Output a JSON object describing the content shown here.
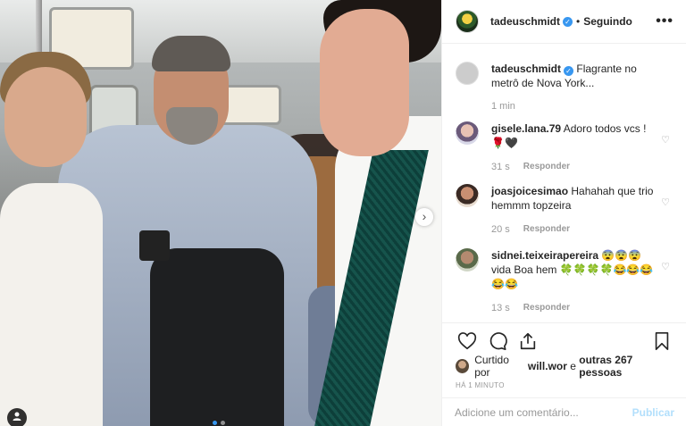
{
  "post": {
    "username": "tadeuschmidt",
    "follow_status": "Seguindo",
    "more_icon": "•••"
  },
  "caption": {
    "username": "tadeuschmidt",
    "text": "Flagrante no metrô de Nova York...",
    "time": "1 min"
  },
  "comments": [
    {
      "username": "gisele.lana.79",
      "text": "Adoro todos vcs ! 🌹🖤",
      "time": "31 s",
      "reply": "Responder"
    },
    {
      "username": "joasjoicesimao",
      "text": "Hahahah que trio hemmm topzeira",
      "time": "20 s",
      "reply": "Responder"
    },
    {
      "username": "sidnei.teixeirapereira",
      "text": "😨😨😨vida Boa hem 🍀🍀🍀🍀😂😂😂😂😂",
      "time": "13 s",
      "reply": "Responder"
    }
  ],
  "likes": {
    "prefix": "Curtido por",
    "first_user": "will.wor",
    "connector": "e",
    "others": "outras 267 pessoas"
  },
  "timestamp": "HÁ 1 MINUTO",
  "add_comment": {
    "placeholder": "Adicione um comentário...",
    "post_label": "Publicar"
  },
  "icons": {
    "verified": "verified-badge",
    "heart": "heart-icon",
    "comment": "comment-icon",
    "share": "share-icon",
    "bookmark": "bookmark-icon"
  },
  "colors": {
    "link_blue": "#3897f0",
    "post_disabled": "#b2dffc",
    "muted_text": "#999999"
  }
}
